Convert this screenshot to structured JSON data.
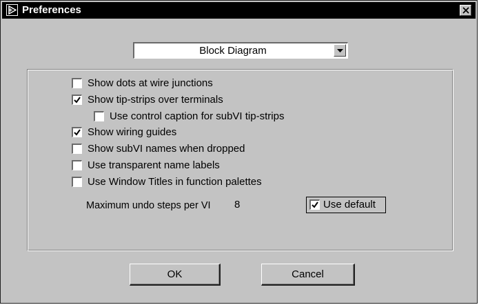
{
  "window": {
    "title": "Preferences"
  },
  "category_select": {
    "selected": "Block Diagram"
  },
  "options": [
    {
      "label": "Show dots at wire junctions",
      "checked": false
    },
    {
      "label": "Show tip-strips over terminals",
      "checked": true
    },
    {
      "label": "Use control caption for subVI tip-strips",
      "checked": false
    },
    {
      "label": "Show wiring guides",
      "checked": true
    },
    {
      "label": "Show subVI names when dropped",
      "checked": false
    },
    {
      "label": "Use transparent name labels",
      "checked": false
    },
    {
      "label": "Use Window Titles in function palettes",
      "checked": false
    }
  ],
  "undo": {
    "label": "Maximum undo steps per VI",
    "value": "8",
    "use_default_label": "Use default",
    "use_default_checked": true
  },
  "buttons": {
    "ok": "OK",
    "cancel": "Cancel"
  },
  "colors": {
    "window_bg": "#c3c3c3",
    "titlebar_bg": "#000000",
    "titlebar_text": "#ffffff"
  }
}
